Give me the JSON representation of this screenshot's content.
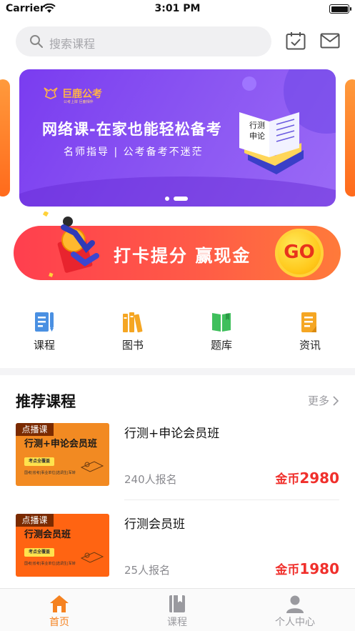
{
  "status_bar": {
    "carrier": "Carrier",
    "time": "3:01 PM"
  },
  "search": {
    "placeholder": "搜索课程",
    "icon": "search-icon"
  },
  "header_icons": [
    "calendar-check-icon",
    "mail-icon"
  ],
  "banner": {
    "brand": "巨鹿公考",
    "brand_sub": "公考上岸 巨鹿相伴",
    "title": "网络课-在家也能轻松备考",
    "subtitle": "名师指导 | 公考备考不迷茫",
    "book_labels": [
      "行测",
      "申论"
    ],
    "active_slide": 2,
    "slides": 2,
    "color": "#8a55f2"
  },
  "checkin": {
    "text": "打卡提分 赢现金",
    "go": "GO"
  },
  "categories": [
    {
      "label": "课程",
      "icon": "course-doc-icon",
      "color": "#4a90e2"
    },
    {
      "label": "图书",
      "icon": "books-icon",
      "color": "#f5a623"
    },
    {
      "label": "题库",
      "icon": "question-bank-icon",
      "color": "#3fbf5c"
    },
    {
      "label": "资讯",
      "icon": "news-doc-icon",
      "color": "#f5a623"
    }
  ],
  "recommended": {
    "title": "推荐课程",
    "more": "更多",
    "courses": [
      {
        "tag": "点播课",
        "thumb_title": "行测+申论会员班",
        "thumb_pill": "考点全覆盖",
        "thumb_meta": "国考|省考|事业单位|选调生|军转",
        "name": "行测+申论会员班",
        "enroll": "240人报名",
        "price_unit": "金币",
        "price": "2980"
      },
      {
        "tag": "点播课",
        "thumb_title": "行测会员班",
        "thumb_pill": "考点全覆盖",
        "thumb_meta": "国考|省考|事业单位|选调生|军转",
        "name": "行测会员班",
        "enroll": "25人报名",
        "price_unit": "金币",
        "price": "1980"
      }
    ]
  },
  "tabbar": [
    {
      "label": "首页",
      "icon": "home-icon",
      "active": true
    },
    {
      "label": "课程",
      "icon": "course-book-icon",
      "active": false
    },
    {
      "label": "个人中心",
      "icon": "person-icon",
      "active": false
    }
  ],
  "colors": {
    "accent": "#f58220",
    "price": "#f0302c",
    "checkin": "#ff4a4a"
  }
}
